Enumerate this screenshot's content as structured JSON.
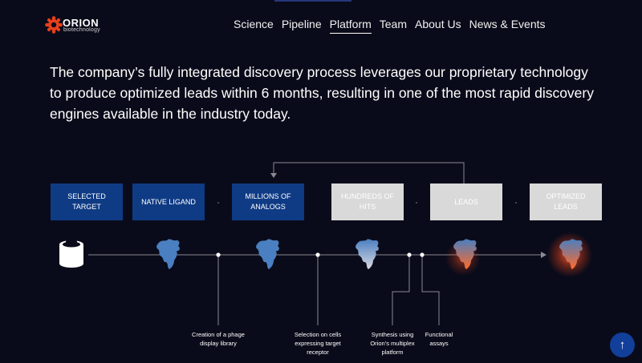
{
  "logo": {
    "name": "ORION",
    "subtitle": "biotechnology"
  },
  "nav": {
    "items": [
      "Science",
      "Pipeline",
      "Platform",
      "Team",
      "About Us",
      "News & Events"
    ],
    "active": "Platform"
  },
  "intro": {
    "text": "The company’s fully integrated discovery process leverages our proprietary technology to produce optimized leads within 6 months, resulting in one of the most rapid discovery engines available in the industry today."
  },
  "stages": [
    {
      "label": "Selected Target",
      "state": "active"
    },
    {
      "label": "Native Ligand",
      "state": "active"
    },
    {
      "label": "Millions of Analogs",
      "state": "active"
    },
    {
      "label": "Hundreds of Hits",
      "state": "inactive"
    },
    {
      "label": "Leads",
      "state": "inactive"
    },
    {
      "label": "Optimized Leads",
      "state": "inactive"
    }
  ],
  "captions": [
    "Creation of a phage display library",
    "Selection on cells expressing target receptor",
    "Synthesis using Orion’s multiplex platform",
    "Functional assays"
  ],
  "icons": {
    "logo": "gear-logo-icon",
    "target": "cylinder-target-icon",
    "molecule": "protein-molecule-icon",
    "scroll_top": "arrow-up-icon"
  },
  "colors": {
    "background": "#0a0b1a",
    "stage_active": "#0f3b85",
    "stage_inactive": "#d9d9d9",
    "molecule_blue": "#4a7fc1",
    "glow": "#ff5a28",
    "scroll_button": "#113f9a"
  },
  "scroll_top": {
    "symbol": "↑"
  }
}
